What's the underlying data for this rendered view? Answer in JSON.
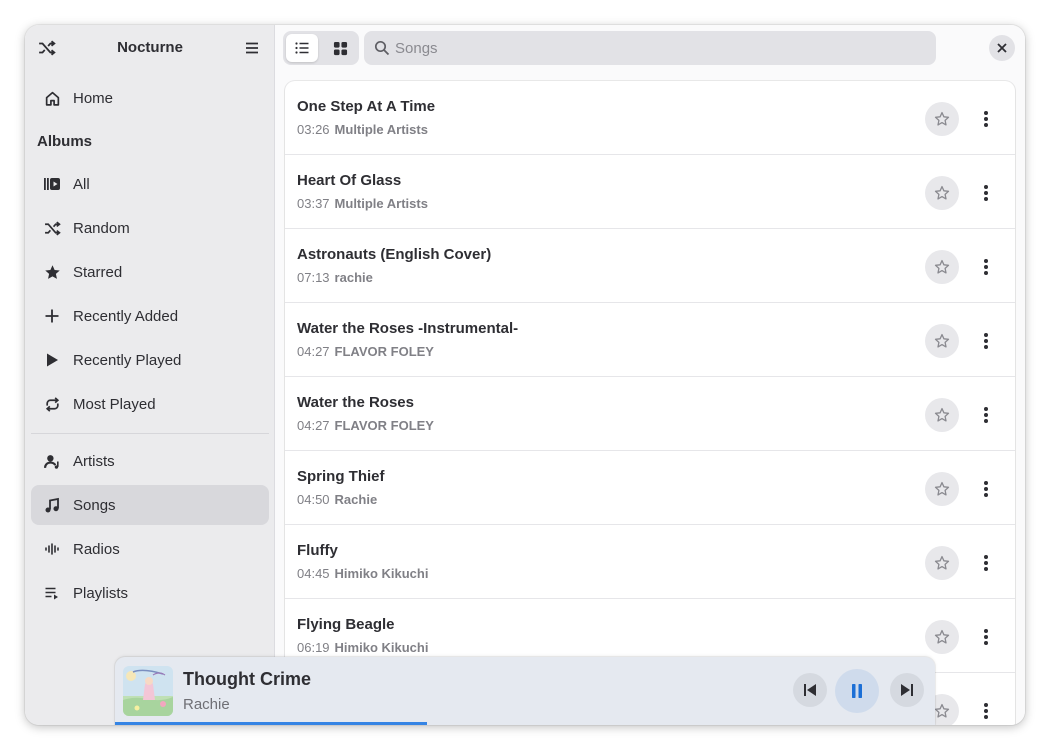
{
  "app": {
    "title": "Nocturne"
  },
  "sidebar": {
    "section_albums": "Albums",
    "items": [
      {
        "label": "Home",
        "icon": "home-icon"
      },
      {
        "label": "All",
        "icon": "albums-icon"
      },
      {
        "label": "Random",
        "icon": "shuffle-icon"
      },
      {
        "label": "Starred",
        "icon": "star-icon"
      },
      {
        "label": "Recently Added",
        "icon": "plus-icon"
      },
      {
        "label": "Recently Played",
        "icon": "play-icon"
      },
      {
        "label": "Most Played",
        "icon": "repeat-icon"
      },
      {
        "label": "Artists",
        "icon": "artist-icon"
      },
      {
        "label": "Songs",
        "icon": "music-note-icon",
        "active": true
      },
      {
        "label": "Radios",
        "icon": "radio-waves-icon"
      },
      {
        "label": "Playlists",
        "icon": "playlist-icon"
      }
    ]
  },
  "toolbar": {
    "search_placeholder": "Songs",
    "view_mode": "list"
  },
  "songs": [
    {
      "title": "One Step At A Time",
      "duration": "03:26",
      "artist": "Multiple Artists"
    },
    {
      "title": "Heart Of Glass",
      "duration": "03:37",
      "artist": "Multiple Artists"
    },
    {
      "title": "Astronauts (English Cover)",
      "duration": "07:13",
      "artist": "rachie"
    },
    {
      "title": "Water the Roses -Instrumental-",
      "duration": "04:27",
      "artist": "FLAVOR FOLEY"
    },
    {
      "title": "Water the Roses",
      "duration": "04:27",
      "artist": "FLAVOR FOLEY"
    },
    {
      "title": "Spring Thief",
      "duration": "04:50",
      "artist": "Rachie"
    },
    {
      "title": "Fluffy",
      "duration": "04:45",
      "artist": "Himiko Kikuchi"
    },
    {
      "title": "Flying Beagle",
      "duration": "06:19",
      "artist": "Himiko Kikuchi"
    }
  ],
  "player": {
    "title": "Thought Crime",
    "artist": "Rachie",
    "progress_fraction": 0.38,
    "state": "playing"
  },
  "colors": {
    "accent": "#3584e4",
    "sidebar_bg": "#ebebed"
  }
}
